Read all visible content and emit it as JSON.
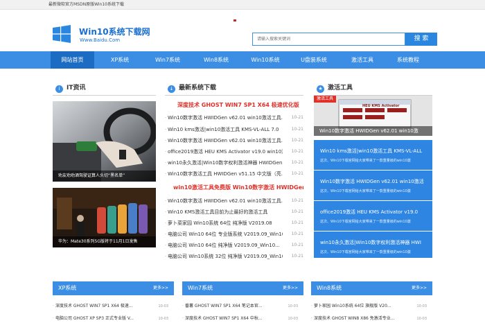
{
  "topbar": {
    "text": "最新微软官方MSDN原版Win10系统下载"
  },
  "header": {
    "title": "Win10系统下载网",
    "subtitle": "Www.Baidu.Com",
    "search_placeholder": "请输入搜索关键词",
    "search_button": "搜 索"
  },
  "nav": {
    "items": [
      "网站首页",
      "XP系统",
      "Win7系统",
      "Win8系统",
      "Win10系统",
      "U盘装系统",
      "激活工具",
      "系统教程"
    ]
  },
  "sections": {
    "it": "IT资讯",
    "latest": "最新系统下载",
    "activation": "激活工具"
  },
  "images": {
    "img1_caption": "劝友劝劝酒驾驶证算人头切“黑名单”",
    "img2_caption": "华为：Mate30系列5G版将于11月1日发售"
  },
  "features": {
    "f1": "深度技术 GHOST WIN7 SP1 X64 极速优化版",
    "f2": "win10激活工具免费版 Win10数字激活 HWIDGen"
  },
  "list1": [
    {
      "title": "Win10数字激活 HWIDGen v62.01 win10激活工具...",
      "date": "10-21"
    },
    {
      "title": "Win10 kms激活|win10激活工具 KMS-VL-ALL 7.0",
      "date": "10-21"
    },
    {
      "title": "Win10数字激活 HWIDGen v62.01 win10激活工具...",
      "date": "10-21"
    },
    {
      "title": "office2019激活 HEU KMS Activator v19.0 win10激...",
      "date": "10-21"
    },
    {
      "title": "win10永久激活|Win10数字权利激活神器 HWIDGen ...",
      "date": "10-21"
    },
    {
      "title": "Win10数字激活工具 HWIDGen v51.15 中文版（亮...",
      "date": "10-21"
    }
  ],
  "list2": [
    {
      "title": "Win10数字激活 HWIDGen v62.01 win10激活工具...",
      "date": "10-21"
    },
    {
      "title": "Win10 KMS激活工具目前为止最好的激活工具",
      "date": "10-21"
    },
    {
      "title": "萝卜菜家园 Win10系统 64位 纯净版 V2019.08",
      "date": "10-21"
    },
    {
      "title": "电脑公司 Win10 64位 专业版系统 V2019.09_Win10...",
      "date": "10-21"
    },
    {
      "title": "电脑公司 Win10 64位 纯净版 V2019.09_Win10...",
      "date": "10-21"
    },
    {
      "title": "电脑公司 Win10系统 32位 纯净版 V2019.09_Win10...",
      "date": "10-21"
    }
  ],
  "activation_top": {
    "badge": "激活工具",
    "window_title": "HEU KMS Activator",
    "caption": "Win10数字激活 HWIDGen v62.01 win10激"
  },
  "activation_cards": [
    {
      "title": "Win10 kms激活|win10激活工具 KMS-VL-ALL",
      "sub": "这次、Win10下载官网给大家带来了一款重量级的win10激"
    },
    {
      "title": "Win10数字激活 HWIDGen v62.01 win10激活",
      "sub": "这次、Win10下载官网给大家带来了一款重量级的win10激"
    },
    {
      "title": "office2019激活 HEU KMS Activator v19.0",
      "sub": "这次、Win10下载官网给大家带来了一款重量级的win10激"
    },
    {
      "title": "win10永久激活|Win10数字权利激活神器 HWI",
      "sub": "这次、Win10下载官网给大家带来了一款重量级的win10激"
    }
  ],
  "bottom": {
    "more": "更多>>",
    "xp": {
      "title": "XP系统",
      "items": [
        {
          "title": "深度技术 GHOST WIN7 SP1 X64 极速...",
          "date": "10-03"
        },
        {
          "title": "电脑公司 GHOST XP SP3 正式专业版 V...",
          "date": "10-03"
        }
      ]
    },
    "win7": {
      "title": "Win7系统",
      "items": [
        {
          "title": "番薯 GHOST WIN7 SP1 X64 笔记本官...",
          "date": "10-03"
        },
        {
          "title": "深度技术 GHOST WIN7 SP1 X64 中秋...",
          "date": "10-03"
        }
      ]
    },
    "win8": {
      "title": "Win8系统",
      "items": [
        {
          "title": "萝卜家园 Win10系统 64位 旗舰版 V20...",
          "date": "10-03"
        },
        {
          "title": "深度技术 GHOST WIN8 X86 免激活专业...",
          "date": "10-03"
        }
      ]
    }
  }
}
